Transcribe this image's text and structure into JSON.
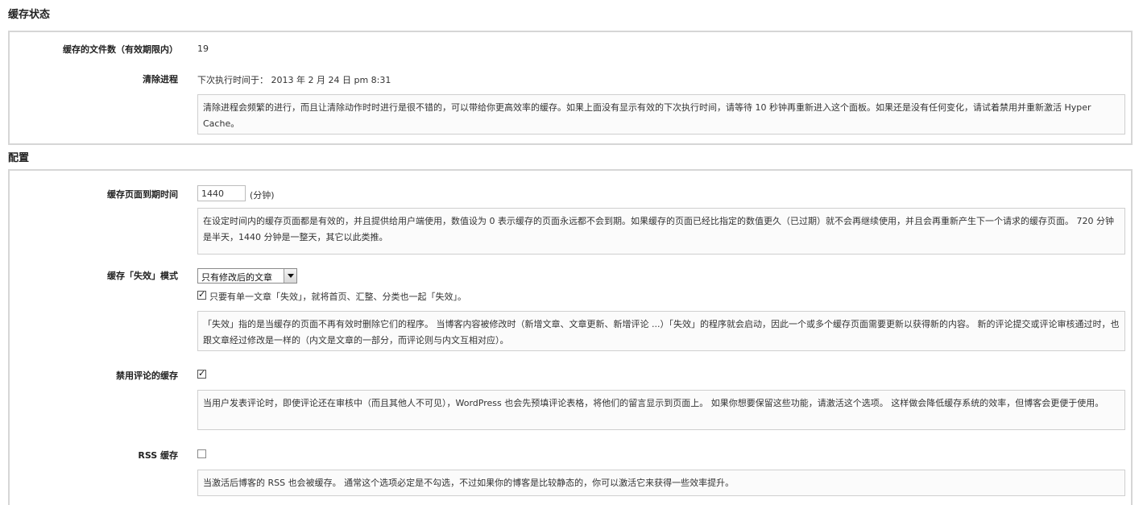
{
  "cache_status": {
    "title": "缓存状态",
    "file_count_label": "缓存的文件数（有效期限内）",
    "file_count_value": "19",
    "cleanup_label": "清除进程",
    "cleanup_value": "下次执行时间于： 2013 年 2 月 24 日 pm 8:31",
    "cleanup_desc": "清除进程会频繁的进行，而且让清除动作时时进行是很不错的，可以带给你更高效率的缓存。如果上面没有显示有效的下次执行时间，请等待 10 秒钟再重新进入这个面板。如果还是没有任何变化，请试着禁用并重新激活 Hyper Cache。"
  },
  "config": {
    "title": "配置",
    "expire": {
      "label": "缓存页面到期时间",
      "value": "1440",
      "unit": "(分钟)",
      "desc": "在设定时间内的缓存页面都是有效的，并且提供给用户端使用，数值设为 0 表示缓存的页面永远都不会到期。如果缓存的页面已经比指定的数值更久（已过期）就不会再继续使用，并且会再重新产生下一个请求的缓存页面。 720 分钟是半天，1440 分钟是一整天，其它以此类推。"
    },
    "invalidation": {
      "label": "缓存「失效」模式",
      "selected_option": "只有修改后的文章",
      "checkbox_label": "只要有单一文章「失效」，就将首页、汇整、分类也一起「失效」。",
      "checkbox_checked": true,
      "desc": "「失效」指的是当缓存的页面不再有效时删除它们的程序。 当博客内容被修改时（新增文章、文章更新、新增评论 ...）「失效」的程序就会启动，因此一个或多个缓存页面需要更新以获得新的内容。 新的评论提交或评论审核通过时，也跟文章经过修改是一样的（内文是文章的一部分，而评论则与内文互相对应）。"
    },
    "disable_comments": {
      "label": "禁用评论的缓存",
      "checked": true,
      "desc": "当用户发表评论时，即使评论还在审核中（而且其他人不可见），WordPress 也会先预填评论表格，将他们的留言显示到页面上。 如果你想要保留这些功能，请激活这个选项。 这样做会降低缓存系统的效率，但博客会更便于使用。"
    },
    "rss": {
      "label": "RSS 缓存",
      "checked": false,
      "desc": "当激活后博客的 RSS 也会被缓存。 通常这个选项必定是不勾选，不过如果你的博客是比较静态的，你可以激活它来获得一些效率提升。"
    }
  }
}
